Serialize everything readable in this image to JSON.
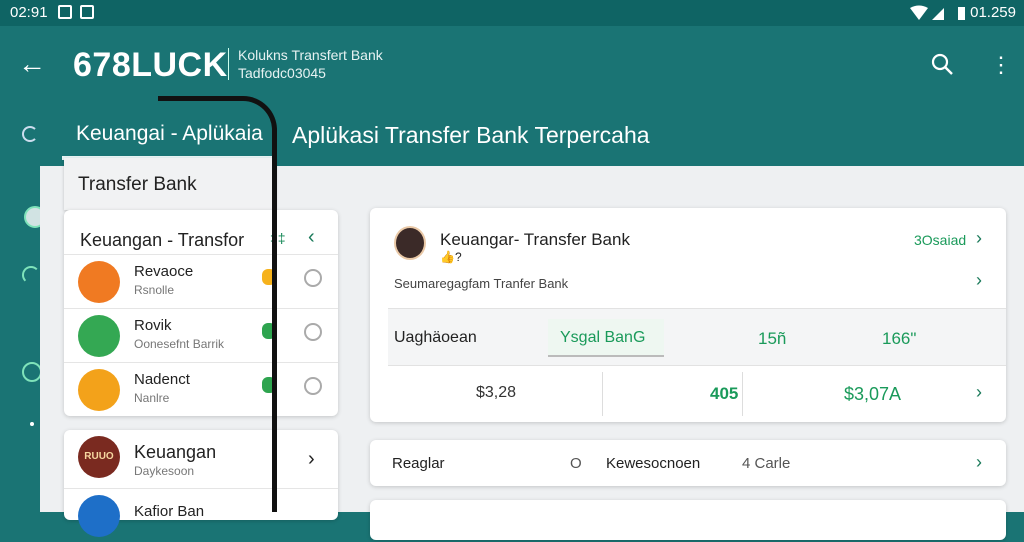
{
  "status_bar": {
    "time": "02:91",
    "right_text": "01.259"
  },
  "app_bar": {
    "back_icon": "arrow-left-icon",
    "brand": "678LUCK",
    "subtitle_line1": "Kolukns Transfert Bank",
    "subtitle_line2": "Tadfodc03045",
    "search_icon": "search-icon",
    "more_icon": "more-vert-icon"
  },
  "tabs": {
    "active": "Keuangai  -  Aplükaia",
    "title": "Aplükasi Transfer Bank Terpercaha"
  },
  "left_panel": {
    "dropdown_label": "Transfer Bank",
    "list_title": "Keuangan - Transfor",
    "list_badge": "‡‡",
    "items": [
      {
        "title": "Revaoce",
        "subtitle": "Rsnolle",
        "color": "#f07a22"
      },
      {
        "title": "Rovik",
        "subtitle": "Oonesefnt Barrik",
        "color": "#34a853"
      },
      {
        "title": "Nadenct",
        "subtitle": "Nanlre",
        "color": "#f3a21a"
      }
    ],
    "second_card": {
      "items": [
        {
          "title": "Keuangan",
          "subtitle": "Daykesoon",
          "badge_text": "RUUO"
        },
        {
          "title": "Kafior Ban",
          "subtitle": ""
        }
      ]
    }
  },
  "main_card": {
    "title": "Keuangar- Transfer Bank",
    "emoji": "👍?",
    "link_text": "3Osaiad",
    "subline": "Seumaregagfam  Tranfer Bank",
    "row1": {
      "label": "Uaghäoean",
      "chip": "Ysgal BanG",
      "v1": "15ñ",
      "v2": "166\""
    },
    "row2": {
      "v1": "$3,28",
      "v2": "405",
      "v3": "$3,07A"
    }
  },
  "bottom_card": {
    "c1": "Reaglar",
    "c2": "O",
    "c3": "Kewesocnoen",
    "c4": "4 Carle"
  }
}
